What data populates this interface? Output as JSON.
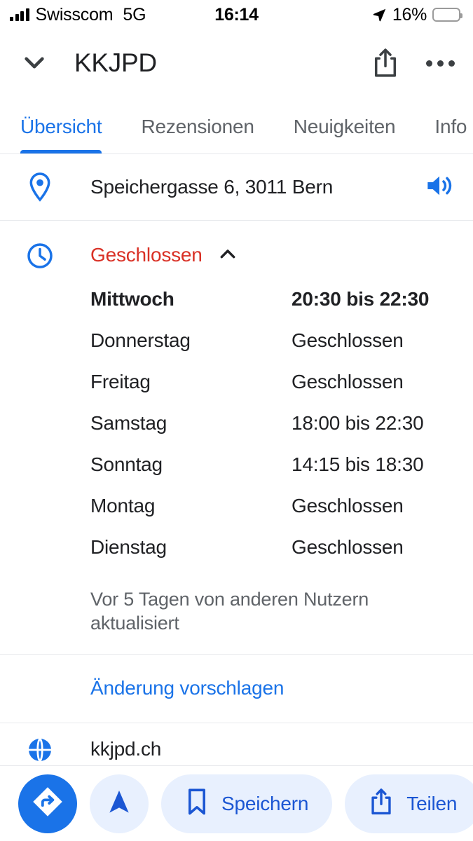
{
  "status_bar": {
    "carrier": "Swisscom",
    "network": "5G",
    "time": "16:14",
    "battery_percent": "16%",
    "battery_level": 16,
    "icons": [
      "signal-bars-icon",
      "location-arrow-icon",
      "battery-icon"
    ]
  },
  "header": {
    "collapse_icon": "chevron-down-icon",
    "title": "KKJPD",
    "share_icon": "share-icon",
    "more_icon": "more-options-icon"
  },
  "tabs": {
    "items": [
      {
        "label": "Übersicht",
        "active": true
      },
      {
        "label": "Rezensionen",
        "active": false
      },
      {
        "label": "Neuigkeiten",
        "active": false
      },
      {
        "label": "Info",
        "active": false
      }
    ]
  },
  "address": {
    "icon": "location-pin-icon",
    "text": "Speichergasse 6, 3011 Bern",
    "trailing_icon": "speaker-icon"
  },
  "hours": {
    "icon": "clock-icon",
    "status": "Geschlossen",
    "toggle_icon": "chevron-up-icon",
    "rows": [
      {
        "day": "Mittwoch",
        "time": "20:30 bis 22:30",
        "today": true
      },
      {
        "day": "Donnerstag",
        "time": "Geschlossen",
        "today": false
      },
      {
        "day": "Freitag",
        "time": "Geschlossen",
        "today": false
      },
      {
        "day": "Samstag",
        "time": "18:00 bis 22:30",
        "today": false
      },
      {
        "day": "Sonntag",
        "time": "14:15 bis 18:30",
        "today": false
      },
      {
        "day": "Montag",
        "time": "Geschlossen",
        "today": false
      },
      {
        "day": "Dienstag",
        "time": "Geschlossen",
        "today": false
      }
    ],
    "updated_note": "Vor 5 Tagen von anderen Nutzern aktualisiert"
  },
  "suggest_edit": {
    "label": "Änderung vorschlagen"
  },
  "website": {
    "icon": "globe-icon",
    "text": "kkjpd.ch"
  },
  "action_bar": {
    "buttons": [
      {
        "name": "directions-button",
        "icon": "directions-icon",
        "label": ""
      },
      {
        "name": "navigate-button",
        "icon": "navigation-arrow-icon",
        "label": ""
      },
      {
        "name": "save-button",
        "icon": "bookmark-icon",
        "label": "Speichern"
      },
      {
        "name": "share-button",
        "icon": "share-icon",
        "label": "Teilen"
      },
      {
        "name": "more-action-button",
        "icon": "circle-icon",
        "label": ""
      }
    ]
  },
  "colors": {
    "accent_blue": "#1a73e8",
    "pill_blue_bg": "#e8f0fe",
    "pill_blue_text": "#1b56d3",
    "closed_red": "#d93025",
    "text_primary": "#202124",
    "text_secondary": "#5f6368",
    "battery_yellow": "#f6cf34",
    "divider": "#e8eaed"
  }
}
